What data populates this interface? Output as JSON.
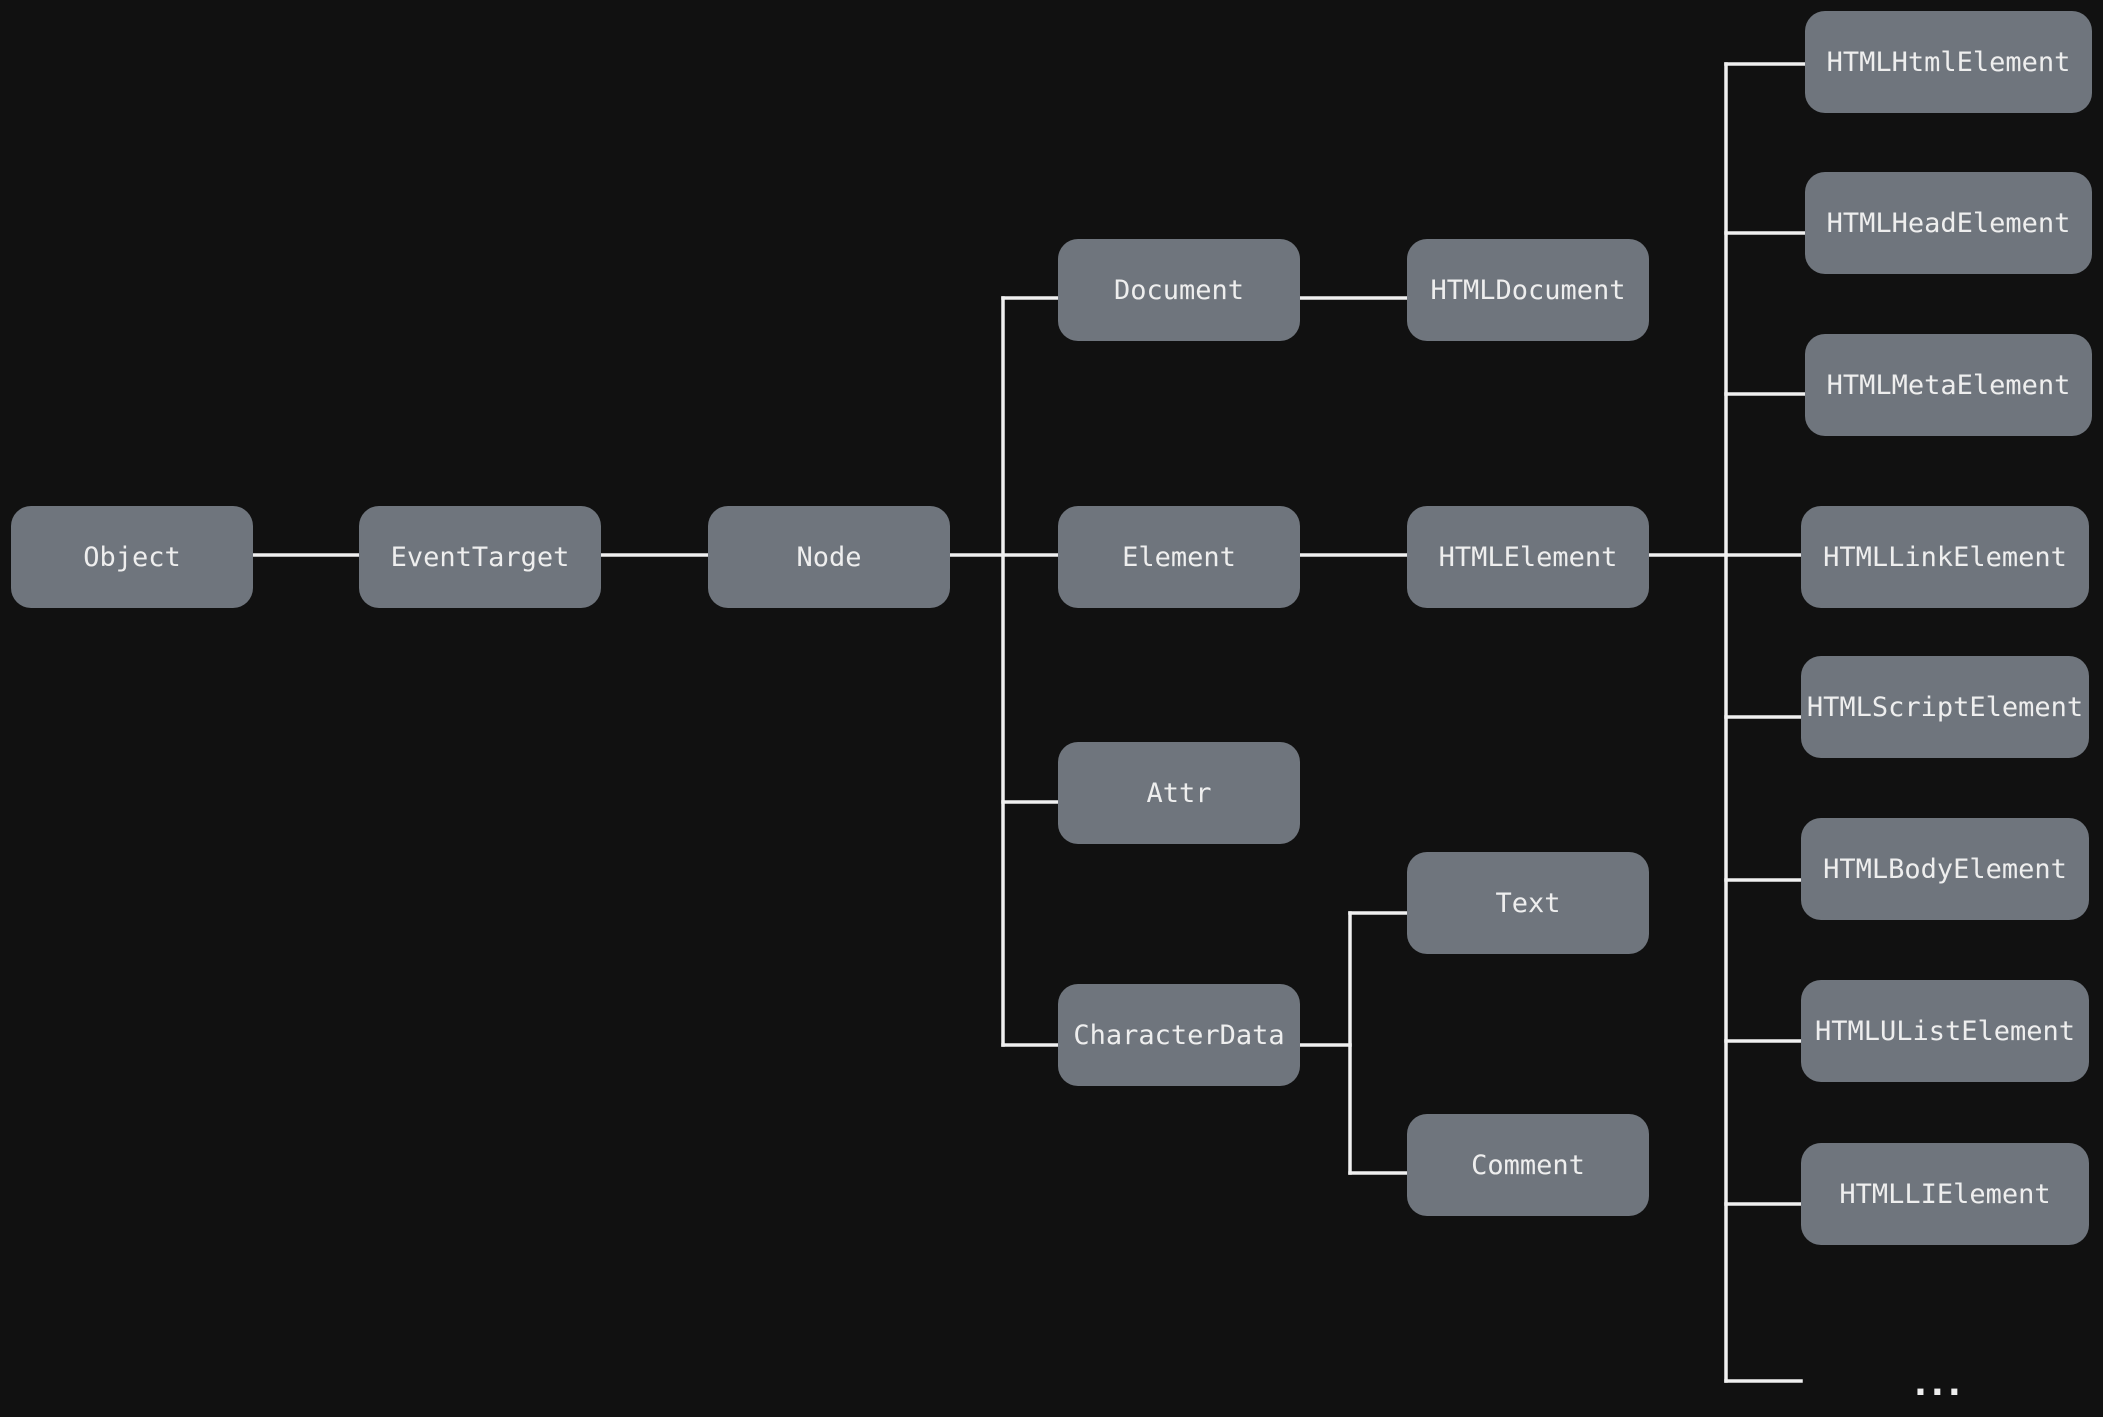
{
  "colors": {
    "background": "#111111",
    "node_fill": "#6f757d",
    "node_text": "#eeeeee",
    "connector": "#f0f0f0"
  },
  "nodes": {
    "object": "Object",
    "eventtarget": "EventTarget",
    "node": "Node",
    "document": "Document",
    "element": "Element",
    "attr": "Attr",
    "characterdata": "CharacterData",
    "htmldocument": "HTMLDocument",
    "htmlelement": "HTMLElement",
    "text": "Text",
    "comment": "Comment",
    "htmlhtmlelement": "HTMLHtmlElement",
    "htmlheadelement": "HTMLHeadElement",
    "htmlmetaelement": "HTMLMetaElement",
    "htmllinkelement": "HTMLLinkElement",
    "htmlscriptelement": "HTMLScriptElement",
    "htmlbodyelement": "HTMLBodyElement",
    "htmlulistelement": "HTMLUListElement",
    "htmllielement": "HTMLLIElement"
  },
  "more_indicator": "..."
}
